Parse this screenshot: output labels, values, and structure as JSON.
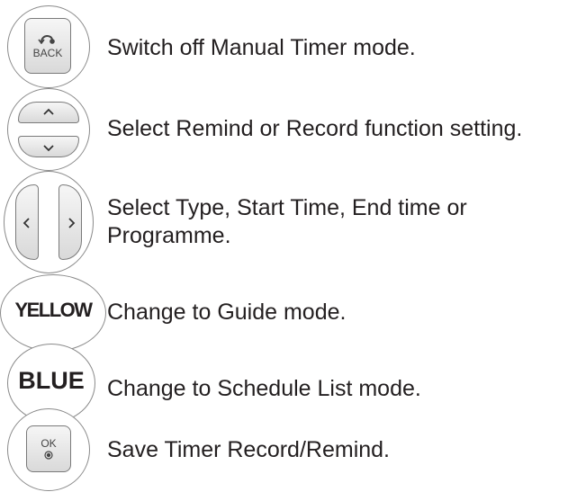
{
  "rows": [
    {
      "key_label": "BACK",
      "text": "Switch off Manual Timer mode."
    },
    {
      "text": "Select Remind or Record function setting."
    },
    {
      "text_line1": "Select Type, Start Time, End time or",
      "text_line2": "Programme."
    },
    {
      "key_label": "YELLOW",
      "text": "Change to Guide mode."
    },
    {
      "key_label": "BLUE",
      "text": "Change to Schedule List mode."
    },
    {
      "key_label": "OK",
      "text": "Save Timer Record/Remind."
    }
  ]
}
